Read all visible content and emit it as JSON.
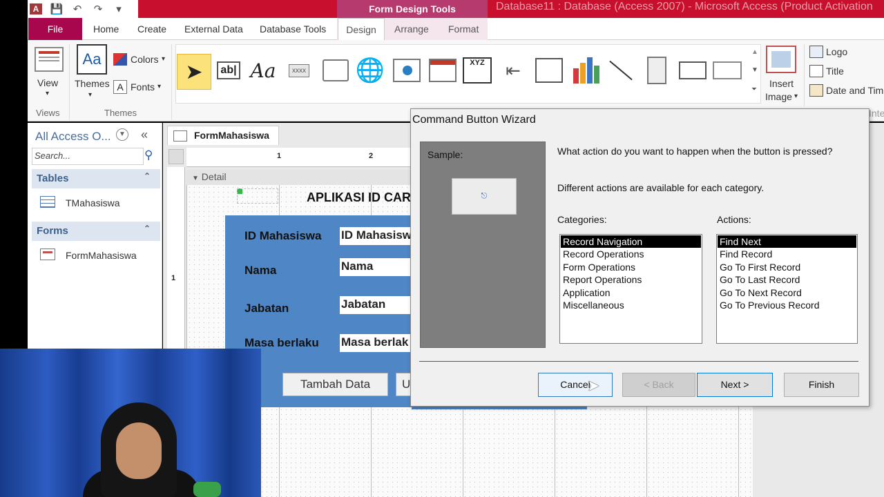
{
  "window": {
    "contextual_title": "Form Design Tools",
    "title": "Database11 : Database (Access 2007) - Microsoft Access (Product Activation"
  },
  "tabs": [
    "File",
    "Home",
    "Create",
    "External Data",
    "Database Tools",
    "Design",
    "Arrange",
    "Format"
  ],
  "ribbon": {
    "view_label": "View",
    "themes_label": "Themes",
    "colors_label": "Colors",
    "fonts_label": "Fonts",
    "group_views": "Views",
    "group_themes": "Themes",
    "insert_image_label": "Insert",
    "insert_image_label2": "Image",
    "logo_label": "Logo",
    "title_label": "Title",
    "datetime_label": "Date and Tim",
    "inter_label": "Inter",
    "textbox_icon": "ab|",
    "label_icon": "Aa",
    "button_icon": "xxxx",
    "option_group_icon": "XYZ"
  },
  "nav": {
    "header": "All Access O...",
    "search_placeholder": "Search...",
    "tables_header": "Tables",
    "table_item": "TMahasiswa",
    "forms_header": "Forms",
    "form_item": "FormMahasiswa"
  },
  "document": {
    "tab_label": "FormMahasiswa",
    "section": "Detail",
    "ruler_1": "1",
    "ruler_2": "2",
    "vruler_1": "1",
    "app_title": "APLIKASI ID CAR",
    "fields": [
      {
        "label": "ID Mahasiswa",
        "value": "ID Mahasisw"
      },
      {
        "label": "Nama",
        "value": "Nama"
      },
      {
        "label": "Jabatan",
        "value": "Jabatan"
      },
      {
        "label": "Masa berlaku",
        "value": "Masa berlak"
      }
    ],
    "button_add": "Tambah Data",
    "button_u": "U"
  },
  "dialog": {
    "title": "Command Button Wizard",
    "sample_label": "Sample:",
    "question": "What action do you want to happen when the button is pressed?",
    "info": "Different actions are available for each category.",
    "categories_label": "Categories:",
    "actions_label": "Actions:",
    "categories": [
      "Record Navigation",
      "Record Operations",
      "Form Operations",
      "Report Operations",
      "Application",
      "Miscellaneous"
    ],
    "actions": [
      "Find Next",
      "Find Record",
      "Go To First Record",
      "Go To Last Record",
      "Go To Next Record",
      "Go To Previous Record"
    ],
    "cancel": "Cancel",
    "back": "< Back",
    "next": "Next >",
    "finish": "Finish"
  }
}
